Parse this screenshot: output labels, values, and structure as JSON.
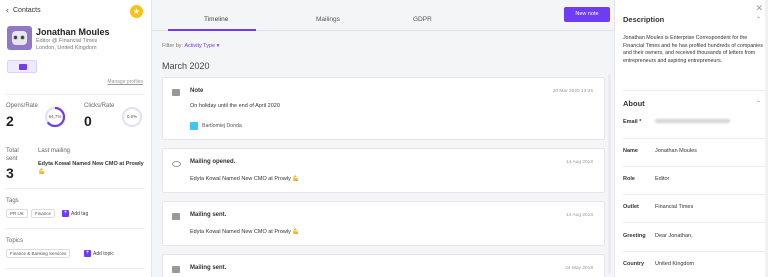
{
  "left": {
    "back_label": "Contacts",
    "name": "Jonathan Moules",
    "title": "Editor @ Financial Times",
    "location": "London, United Kingdom",
    "manage_label": "Manage profiles",
    "opens_rate_label": "Opens/Rate",
    "opens_value": "2",
    "opens_pct": "64,7%",
    "clicks_rate_label": "Clicks/Rate",
    "clicks_value": "0",
    "clicks_pct": "0,0%",
    "total_sent_label": "Total sent",
    "total_sent_value": "3",
    "last_mailing_label": "Last mailing",
    "last_mailing_value": "Edyta Kowal Named New CMO at Prowly 💪",
    "tags_label": "Tags",
    "tags": [
      "PR UK",
      "Finance"
    ],
    "add_tag_label": "Add tag",
    "topics_label": "Topics",
    "topics": [
      "Finance & Banking Services"
    ],
    "add_topic_label": "Add topic",
    "accent_color": "#6e3cf2"
  },
  "tabs": [
    {
      "label": "Timeline"
    },
    {
      "label": "Mailings"
    },
    {
      "label": "GDPR"
    }
  ],
  "new_note_label": "New note",
  "filter_label": "Filter by:",
  "filter_value": "Activity Type",
  "month_label": "March 2020",
  "timeline": [
    {
      "icon": "note-icon",
      "heading": "Note",
      "date": "20 Mar 2020 13:25",
      "body": "On holiday until the end of April 2020",
      "author": "Bartlomiej Donda"
    },
    {
      "icon": "eye-icon",
      "heading": "Mailing opened.",
      "date": "14 Aug 2018",
      "body": "Edyta Kowal Named New CMO at Prowly 💪"
    },
    {
      "icon": "mail-icon",
      "heading": "Mailing sent.",
      "date": "14 Aug 2018",
      "body": "Edyta Kowal Named New CMO at Prowly 💪"
    },
    {
      "icon": "mail-icon",
      "heading": "Mailing sent.",
      "date": "24 May 2018"
    }
  ],
  "right": {
    "description_heading": "Description",
    "description_text": "Jonathan Moules is Enterprise Correspondent for the Financial Times and he has profiled hundreds of companies and their owners, and received thousands of letters from entrepreneurs and aspiring entrepreneurs.",
    "about_heading": "About",
    "fields": [
      {
        "key": "Email *",
        "value": ""
      },
      {
        "key": "Name",
        "value": "Jonathan Moules"
      },
      {
        "key": "Role",
        "value": "Editor"
      },
      {
        "key": "Outlet",
        "value": "Financial Times"
      },
      {
        "key": "Greeting",
        "value": "Dear Jonathan,"
      },
      {
        "key": "Country",
        "value": "United Kingdom"
      }
    ]
  }
}
